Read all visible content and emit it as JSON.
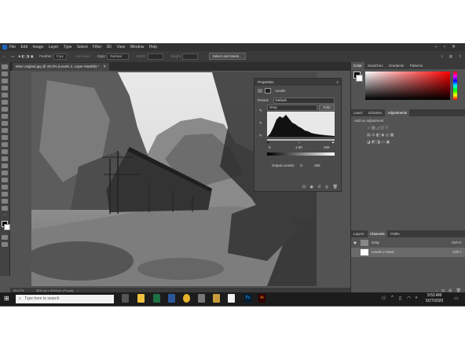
{
  "menubar": {
    "items": [
      "File",
      "Edit",
      "Image",
      "Layer",
      "Type",
      "Select",
      "Filter",
      "3D",
      "View",
      "Window",
      "Help"
    ]
  },
  "options": {
    "feather_label": "Feather:",
    "feather_value": "0 px",
    "antialias": "Anti-alias",
    "style_label": "Style:",
    "style_value": "Normal",
    "width_label": "Width:",
    "height_label": "Height:",
    "select_mask": "Select and Mask..."
  },
  "document": {
    "tab_title": "Mine original.jpg @ 29.2% (Levels 2, Layer Mask/8) *",
    "zoom": "29.27%",
    "doc_info": "4032 px x 3024 px (72 ppi)"
  },
  "properties": {
    "title": "Properties",
    "adjustment": "Levels",
    "preset_label": "Preset:",
    "preset_value": "Default",
    "channel": "Gray",
    "auto_label": "Auto",
    "input_black": "0",
    "input_gamma": "1.00",
    "input_white": "255",
    "output_label": "Output Levels:",
    "output_black": "0",
    "output_white": "255"
  },
  "color_panel": {
    "tabs": [
      "Color",
      "Swatches",
      "Gradients",
      "Patterns"
    ]
  },
  "adjustments_panel": {
    "tabs": [
      "Learn",
      "Libraries",
      "Adjustments"
    ],
    "add_label": "Add an adjustment"
  },
  "layers_panel": {
    "tabs": [
      "Layers",
      "Channels",
      "Paths"
    ],
    "rows": [
      {
        "name": "Gray",
        "shortcut": "Ctrl+2"
      },
      {
        "name": "Levels 2 Mask",
        "shortcut": "Ctrl+\\"
      }
    ]
  },
  "taskbar": {
    "search_placeholder": "Type here to search",
    "time": "9:53 AM",
    "date": "5/27/2020",
    "apps": [
      "task-view",
      "file-explorer",
      "excel",
      "word",
      "chrome",
      "calculator",
      "settings-tool",
      "photoshop",
      "illustrator"
    ]
  },
  "colors": {
    "ps_bg": "#535353",
    "panel_dark": "#3a3a3a",
    "taskbar": "#1c1c1c",
    "photoshop_blue": "#31a8ff",
    "illustrator_orange": "#ff9a00"
  }
}
